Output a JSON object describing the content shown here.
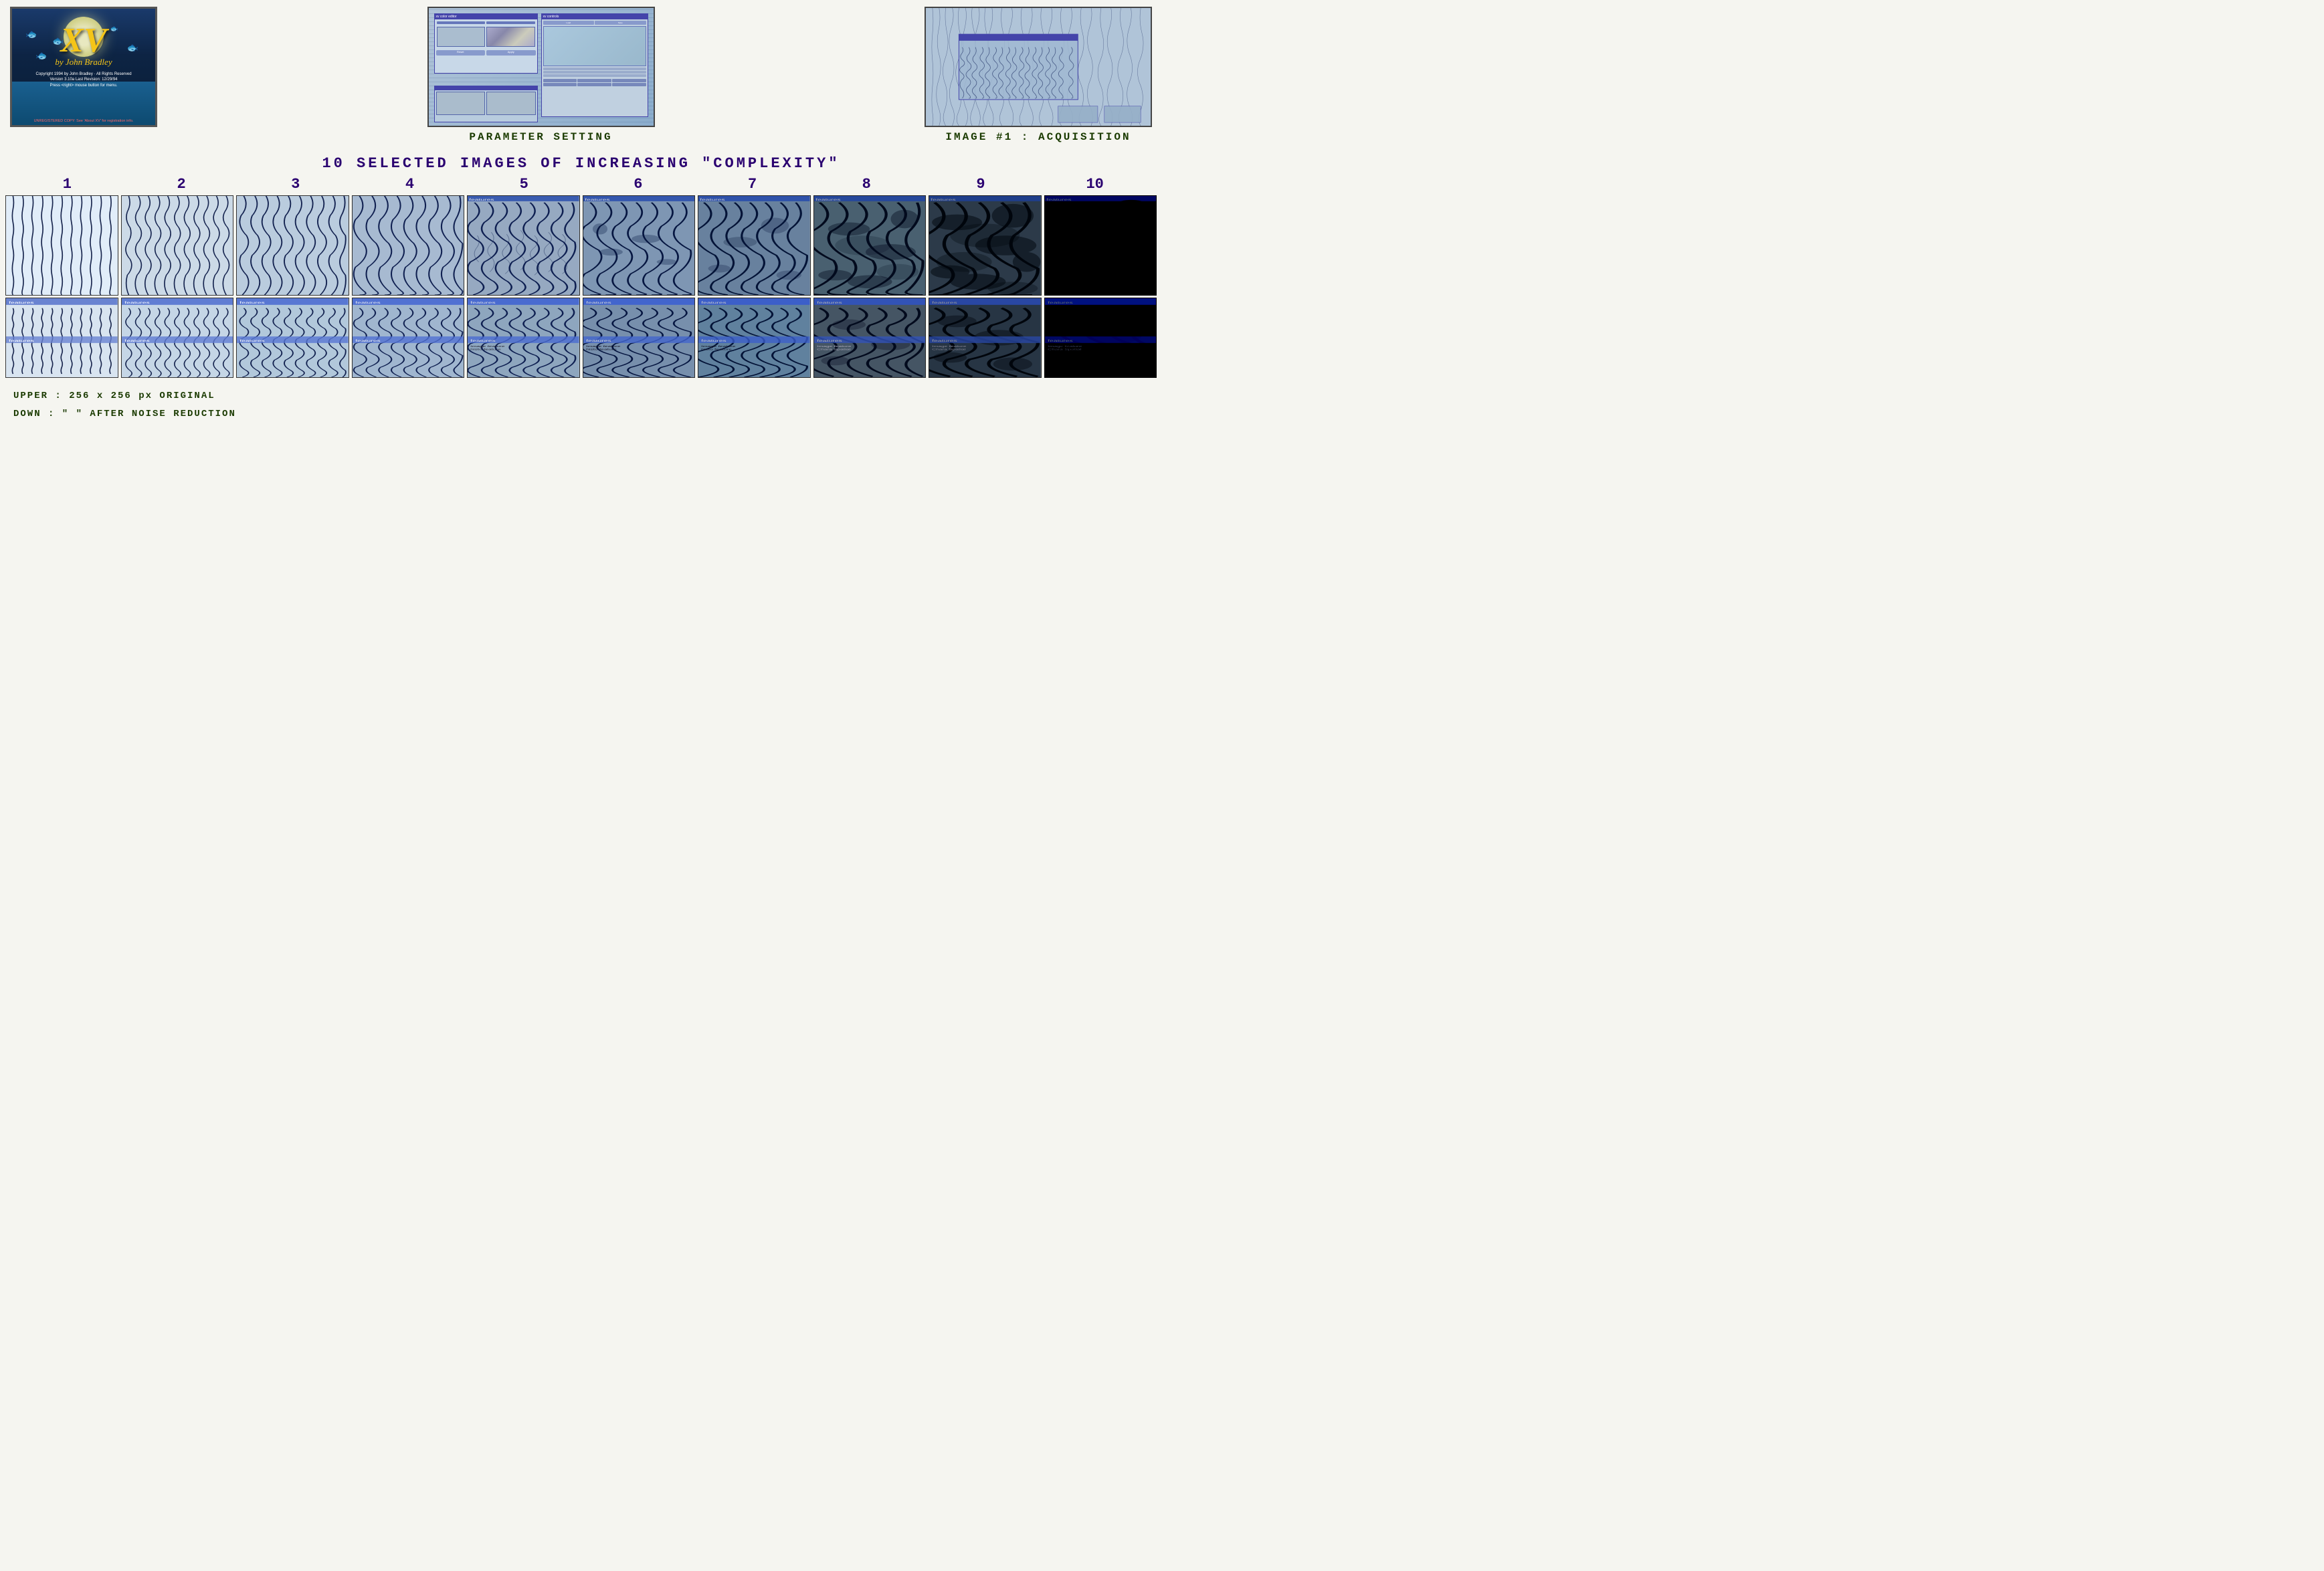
{
  "page": {
    "background": "#f5f5f0"
  },
  "splash": {
    "title": "XV",
    "subtitle": "by John Bradley",
    "copyright": "Copyright 1994 by John Bradley  ·  All Rights Reserved",
    "version": "Version 3.10a    Last Revision: 12/29/94",
    "press": "Press <right> mouse button for menu.",
    "unreg": "UNREGISTERED COPY:  See 'About XV' for registration info."
  },
  "sections": {
    "param_label": "PARAMETER   SETTING",
    "acq_label": "IMAGE #1 : ACQUISITION"
  },
  "middle_title": "10  SELECTED  IMAGES  OF  INCREASING  \"COMPLEXITY\"",
  "numbers": [
    "1",
    "2",
    "3",
    "4",
    "5",
    "6",
    "7",
    "8",
    "9",
    "10"
  ],
  "legend": {
    "upper": "UPPER :   256 x 256 px ORIGINAL",
    "down": "DOWN  :    \"       \"  AFTER  NOISE  REDUCTION"
  },
  "images": [
    {
      "id": 1,
      "complexity": 1,
      "label": "features"
    },
    {
      "id": 2,
      "complexity": 2,
      "label": "features"
    },
    {
      "id": 3,
      "complexity": 3,
      "label": "features"
    },
    {
      "id": 4,
      "complexity": 4,
      "label": "features"
    },
    {
      "id": 5,
      "complexity": 5,
      "label": "features"
    },
    {
      "id": 6,
      "complexity": 6,
      "label": "features"
    },
    {
      "id": 7,
      "complexity": 7,
      "label": "features"
    },
    {
      "id": 8,
      "complexity": 8,
      "label": "features"
    },
    {
      "id": 9,
      "complexity": 9,
      "label": "features"
    },
    {
      "id": 10,
      "complexity": 10,
      "label": "features"
    }
  ]
}
